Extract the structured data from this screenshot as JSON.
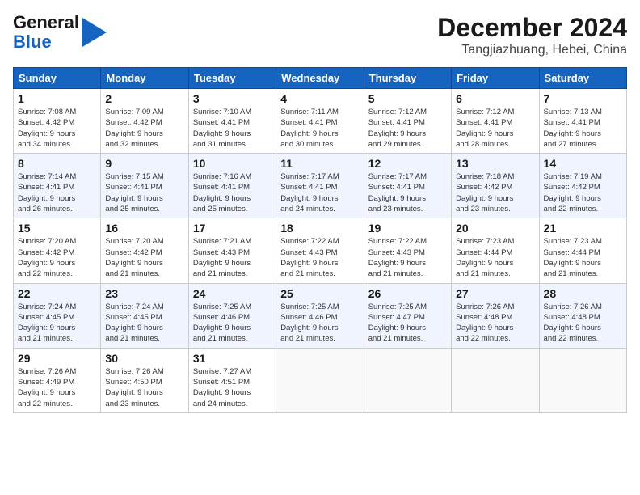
{
  "header": {
    "logo_general": "General",
    "logo_blue": "Blue",
    "title": "December 2024",
    "subtitle": "Tangjiazhuang, Hebei, China"
  },
  "weekdays": [
    "Sunday",
    "Monday",
    "Tuesday",
    "Wednesday",
    "Thursday",
    "Friday",
    "Saturday"
  ],
  "weeks": [
    [
      {
        "day": "1",
        "info": "Sunrise: 7:08 AM\nSunset: 4:42 PM\nDaylight: 9 hours\nand 34 minutes."
      },
      {
        "day": "2",
        "info": "Sunrise: 7:09 AM\nSunset: 4:42 PM\nDaylight: 9 hours\nand 32 minutes."
      },
      {
        "day": "3",
        "info": "Sunrise: 7:10 AM\nSunset: 4:41 PM\nDaylight: 9 hours\nand 31 minutes."
      },
      {
        "day": "4",
        "info": "Sunrise: 7:11 AM\nSunset: 4:41 PM\nDaylight: 9 hours\nand 30 minutes."
      },
      {
        "day": "5",
        "info": "Sunrise: 7:12 AM\nSunset: 4:41 PM\nDaylight: 9 hours\nand 29 minutes."
      },
      {
        "day": "6",
        "info": "Sunrise: 7:12 AM\nSunset: 4:41 PM\nDaylight: 9 hours\nand 28 minutes."
      },
      {
        "day": "7",
        "info": "Sunrise: 7:13 AM\nSunset: 4:41 PM\nDaylight: 9 hours\nand 27 minutes."
      }
    ],
    [
      {
        "day": "8",
        "info": "Sunrise: 7:14 AM\nSunset: 4:41 PM\nDaylight: 9 hours\nand 26 minutes."
      },
      {
        "day": "9",
        "info": "Sunrise: 7:15 AM\nSunset: 4:41 PM\nDaylight: 9 hours\nand 25 minutes."
      },
      {
        "day": "10",
        "info": "Sunrise: 7:16 AM\nSunset: 4:41 PM\nDaylight: 9 hours\nand 25 minutes."
      },
      {
        "day": "11",
        "info": "Sunrise: 7:17 AM\nSunset: 4:41 PM\nDaylight: 9 hours\nand 24 minutes."
      },
      {
        "day": "12",
        "info": "Sunrise: 7:17 AM\nSunset: 4:41 PM\nDaylight: 9 hours\nand 23 minutes."
      },
      {
        "day": "13",
        "info": "Sunrise: 7:18 AM\nSunset: 4:42 PM\nDaylight: 9 hours\nand 23 minutes."
      },
      {
        "day": "14",
        "info": "Sunrise: 7:19 AM\nSunset: 4:42 PM\nDaylight: 9 hours\nand 22 minutes."
      }
    ],
    [
      {
        "day": "15",
        "info": "Sunrise: 7:20 AM\nSunset: 4:42 PM\nDaylight: 9 hours\nand 22 minutes."
      },
      {
        "day": "16",
        "info": "Sunrise: 7:20 AM\nSunset: 4:42 PM\nDaylight: 9 hours\nand 21 minutes."
      },
      {
        "day": "17",
        "info": "Sunrise: 7:21 AM\nSunset: 4:43 PM\nDaylight: 9 hours\nand 21 minutes."
      },
      {
        "day": "18",
        "info": "Sunrise: 7:22 AM\nSunset: 4:43 PM\nDaylight: 9 hours\nand 21 minutes."
      },
      {
        "day": "19",
        "info": "Sunrise: 7:22 AM\nSunset: 4:43 PM\nDaylight: 9 hours\nand 21 minutes."
      },
      {
        "day": "20",
        "info": "Sunrise: 7:23 AM\nSunset: 4:44 PM\nDaylight: 9 hours\nand 21 minutes."
      },
      {
        "day": "21",
        "info": "Sunrise: 7:23 AM\nSunset: 4:44 PM\nDaylight: 9 hours\nand 21 minutes."
      }
    ],
    [
      {
        "day": "22",
        "info": "Sunrise: 7:24 AM\nSunset: 4:45 PM\nDaylight: 9 hours\nand 21 minutes."
      },
      {
        "day": "23",
        "info": "Sunrise: 7:24 AM\nSunset: 4:45 PM\nDaylight: 9 hours\nand 21 minutes."
      },
      {
        "day": "24",
        "info": "Sunrise: 7:25 AM\nSunset: 4:46 PM\nDaylight: 9 hours\nand 21 minutes."
      },
      {
        "day": "25",
        "info": "Sunrise: 7:25 AM\nSunset: 4:46 PM\nDaylight: 9 hours\nand 21 minutes."
      },
      {
        "day": "26",
        "info": "Sunrise: 7:25 AM\nSunset: 4:47 PM\nDaylight: 9 hours\nand 21 minutes."
      },
      {
        "day": "27",
        "info": "Sunrise: 7:26 AM\nSunset: 4:48 PM\nDaylight: 9 hours\nand 22 minutes."
      },
      {
        "day": "28",
        "info": "Sunrise: 7:26 AM\nSunset: 4:48 PM\nDaylight: 9 hours\nand 22 minutes."
      }
    ],
    [
      {
        "day": "29",
        "info": "Sunrise: 7:26 AM\nSunset: 4:49 PM\nDaylight: 9 hours\nand 22 minutes."
      },
      {
        "day": "30",
        "info": "Sunrise: 7:26 AM\nSunset: 4:50 PM\nDaylight: 9 hours\nand 23 minutes."
      },
      {
        "day": "31",
        "info": "Sunrise: 7:27 AM\nSunset: 4:51 PM\nDaylight: 9 hours\nand 24 minutes."
      },
      null,
      null,
      null,
      null
    ]
  ]
}
